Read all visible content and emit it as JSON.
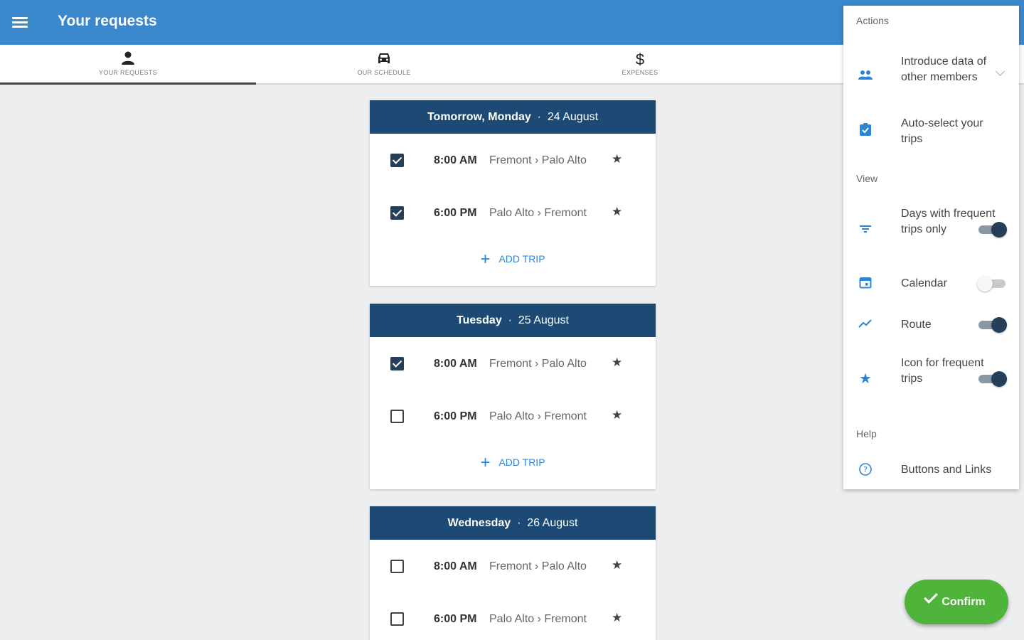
{
  "appbar": {
    "title": "Your requests"
  },
  "tabs": [
    {
      "label": "YOUR REQUESTS",
      "icon": "person-icon"
    },
    {
      "label": "OUR SCHEDULE",
      "icon": "car-icon"
    },
    {
      "label": "EXPENSES",
      "icon": "dollar-icon"
    }
  ],
  "days": [
    {
      "name": "Tomorrow, Monday",
      "date": "24 August",
      "trips": [
        {
          "time": "8:00 AM",
          "route": "Fremont › Palo Alto",
          "checked": true
        },
        {
          "time": "6:00 PM",
          "route": "Palo Alto › Fremont",
          "checked": true
        }
      ],
      "add_label": "ADD TRIP"
    },
    {
      "name": "Tuesday",
      "date": "25 August",
      "trips": [
        {
          "time": "8:00 AM",
          "route": "Fremont › Palo Alto",
          "checked": true
        },
        {
          "time": "6:00 PM",
          "route": "Palo Alto › Fremont",
          "checked": false
        }
      ],
      "add_label": "ADD TRIP"
    },
    {
      "name": "Wednesday",
      "date": "26 August",
      "trips": [
        {
          "time": "8:00 AM",
          "route": "Fremont › Palo Alto",
          "checked": false
        },
        {
          "time": "6:00 PM",
          "route": "Palo Alto › Fremont",
          "checked": false
        }
      ]
    }
  ],
  "panel": {
    "actions_label": "Actions",
    "introduce": "Introduce data of other members",
    "autoselect": "Auto-select your trips",
    "view_label": "View",
    "frequent_days": "Days with frequent trips only",
    "frequent_days_on": true,
    "calendar": "Calendar",
    "calendar_on": false,
    "route": "Route",
    "route_on": true,
    "icon_frequent": "Icon for frequent trips",
    "icon_frequent_on": true,
    "help_label": "Help",
    "buttons_links": "Buttons and Links"
  },
  "confirm_label": "Confirm",
  "colors": {
    "appbar": "#3a87cc",
    "day_header": "#1c4a75",
    "accent": "#2c84d8",
    "confirm": "#4fb43a"
  }
}
